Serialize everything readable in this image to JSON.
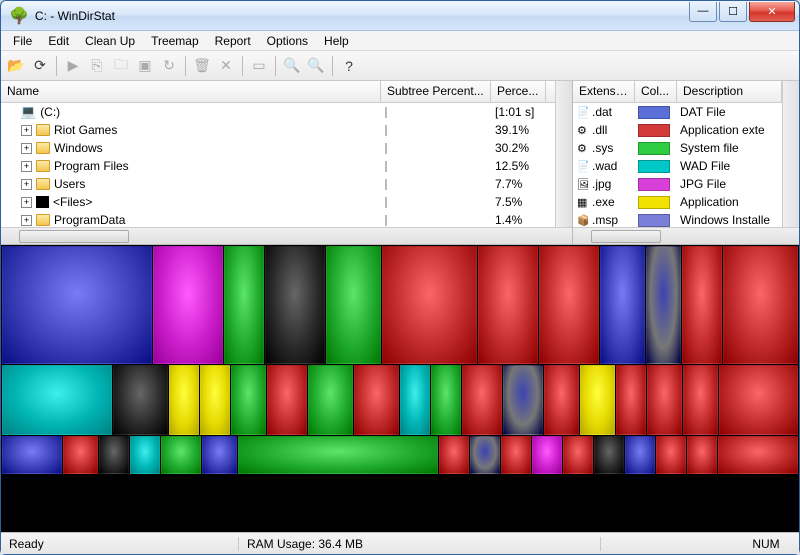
{
  "title": "C: - WinDirStat",
  "menus": [
    "File",
    "Edit",
    "Clean Up",
    "Treemap",
    "Report",
    "Options",
    "Help"
  ],
  "toolbar_icons": [
    {
      "n": "open-icon",
      "g": "📂",
      "e": true
    },
    {
      "n": "refresh-icon",
      "g": "⟳",
      "e": true
    },
    {
      "sep": true
    },
    {
      "n": "play-icon",
      "g": "▶",
      "e": false
    },
    {
      "n": "copy-icon",
      "g": "⎘",
      "e": false
    },
    {
      "n": "explorer-icon",
      "g": "🗀",
      "e": false
    },
    {
      "n": "cmd-icon",
      "g": "▣",
      "e": false
    },
    {
      "n": "reload-icon",
      "g": "↻",
      "e": false
    },
    {
      "sep": true
    },
    {
      "n": "delete-recycle-icon",
      "g": "🗑",
      "e": false
    },
    {
      "n": "delete-icon",
      "g": "✕",
      "e": false
    },
    {
      "sep": true
    },
    {
      "n": "show-treemap-icon",
      "g": "▭",
      "e": false
    },
    {
      "sep": true
    },
    {
      "n": "zoom-in-icon",
      "g": "🔍",
      "e": false
    },
    {
      "n": "zoom-out-icon",
      "g": "🔍",
      "e": false
    },
    {
      "sep": true
    },
    {
      "n": "help-icon",
      "g": "?",
      "e": true
    }
  ],
  "dir_columns": {
    "name": "Name",
    "subtree": "Subtree Percent...",
    "percent": "Perce..."
  },
  "dir_rows": [
    {
      "indent": 0,
      "exp": "",
      "icon": "drive",
      "label": "(C:)",
      "bar": 100,
      "bar_color": "blue",
      "pct": "[1:01 s]"
    },
    {
      "indent": 1,
      "exp": "+",
      "icon": "folder",
      "label": "Riot Games",
      "bar": 39.1,
      "pct": "39.1%"
    },
    {
      "indent": 1,
      "exp": "+",
      "icon": "folder",
      "label": "Windows",
      "bar": 30.2,
      "pct": "30.2%"
    },
    {
      "indent": 1,
      "exp": "+",
      "icon": "folder",
      "label": "Program Files",
      "bar": 12.5,
      "pct": "12.5%"
    },
    {
      "indent": 1,
      "exp": "+",
      "icon": "folder",
      "label": "Users",
      "bar": 7.7,
      "pct": "7.7%"
    },
    {
      "indent": 1,
      "exp": "+",
      "icon": "black",
      "label": "<Files>",
      "bar": 7.5,
      "pct": "7.5%"
    },
    {
      "indent": 1,
      "exp": "+",
      "icon": "folder",
      "label": "ProgramData",
      "bar": 1.4,
      "pct": "1.4%"
    }
  ],
  "ext_columns": {
    "ext": "Extensi...",
    "color": "Col...",
    "desc": "Description"
  },
  "ext_rows": [
    {
      "ico": "📄",
      "ext": ".dat",
      "color": "#5a6fd8",
      "desc": "DAT File"
    },
    {
      "ico": "⚙",
      "ext": ".dll",
      "color": "#d33a3a",
      "desc": "Application exte"
    },
    {
      "ico": "⚙",
      "ext": ".sys",
      "color": "#2ecc40",
      "desc": "System file"
    },
    {
      "ico": "📄",
      "ext": ".wad",
      "color": "#00c8c8",
      "desc": "WAD File"
    },
    {
      "ico": "🖼",
      "ext": ".jpg",
      "color": "#d940d9",
      "desc": "JPG File"
    },
    {
      "ico": "▦",
      "ext": ".exe",
      "color": "#f2e200",
      "desc": "Application"
    },
    {
      "ico": "📦",
      "ext": ".msp",
      "color": "#7a7fd8",
      "desc": "Windows Installe"
    }
  ],
  "status": {
    "ready": "Ready",
    "ram": "RAM Usage:   36.4 MB",
    "num": "NUM"
  },
  "treemap_palette": {
    "blue": "#3b3fb8",
    "red": "#c02a2a",
    "green": "#1faa2e",
    "cyan": "#00b4b4",
    "magenta": "#cc1fcc",
    "yellow": "#e6da00",
    "grey": "#777",
    "dgrey": "#2a2a2a",
    "lblue": "#6a6fe0"
  }
}
